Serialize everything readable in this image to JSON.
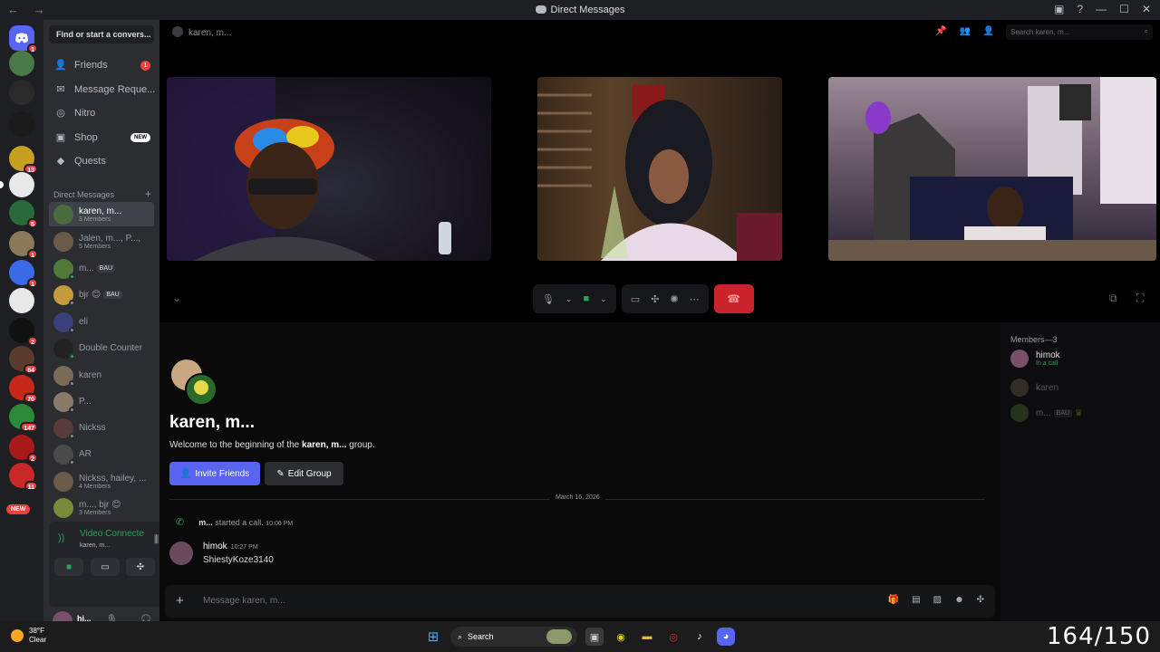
{
  "window": {
    "title": "Direct Messages",
    "nav_arrows": "← →",
    "controls": [
      "▣",
      "?",
      "—",
      "☐",
      "✕"
    ]
  },
  "rail": {
    "badges": [
      "1",
      "13",
      "5",
      "1",
      "1",
      "2",
      "64",
      "70",
      "147",
      "2",
      "11"
    ],
    "new_label": "NEW"
  },
  "sidebar": {
    "search_label": "Find or start a convers...",
    "nav": [
      {
        "label": "Friends",
        "icon": "friends-icon",
        "count": "1"
      },
      {
        "label": "Message Reque...",
        "icon": "envelope-icon"
      },
      {
        "label": "Nitro",
        "icon": "nitro-icon"
      },
      {
        "label": "Shop",
        "icon": "shop-icon",
        "tag": "NEW"
      },
      {
        "label": "Quests",
        "icon": "quests-icon"
      }
    ],
    "dm_header": "Direct Messages",
    "dm_add": "+",
    "dms": [
      {
        "name": "karen, m...",
        "sub": "3 Members",
        "active": true,
        "color": "#4a6b3c"
      },
      {
        "name": "Jalen, m..., P...,",
        "sub": "5 Members",
        "color": "#6a5a48"
      },
      {
        "name": "m...",
        "tag": "BAU",
        "color": "#4f7a3a",
        "online": true
      },
      {
        "name": "bjr 😊",
        "tag": "BAU",
        "color": "#c49a3a"
      },
      {
        "name": "eli",
        "color": "#3b3f7a"
      },
      {
        "name": "Double Counter",
        "color": "#222",
        "online": true
      },
      {
        "name": "karen",
        "color": "#7a6a58"
      },
      {
        "name": "P...",
        "color": "#8a7a6a"
      },
      {
        "name": "Nickss",
        "color": "#5a3a3a"
      },
      {
        "name": "AR",
        "color": "#4a4a4a"
      },
      {
        "name": "Nickss, hailey, ...",
        "sub": "4 Members",
        "color": "#6a5a4a"
      },
      {
        "name": "m..., bjr 😊",
        "sub": "3 Members",
        "color": "#7a8a3a"
      }
    ],
    "voice": {
      "title": "Video Connecte",
      "channel": "karen, m..."
    },
    "user": {
      "name": "hi...",
      "status": "In"
    }
  },
  "main": {
    "channel_name": "karen, m...",
    "search_placeholder": "Search karen, m...",
    "group_title": "karen, m...",
    "welcome_prefix": "Welcome to the beginning of the ",
    "welcome_name": "karen, m...",
    "welcome_suffix": " group.",
    "invite_label": "Invite Friends",
    "edit_label": "Edit Group",
    "date_divider": "March 16, 2026",
    "call_user": "m...",
    "call_text": " started a call.",
    "call_time": "10:06 PM",
    "message": {
      "author": "himok",
      "time": "10:27 PM",
      "text": "ShiestyKoze3140"
    },
    "composer_placeholder": "Message karen, m..."
  },
  "members": {
    "header": "Members—3",
    "list": [
      {
        "name": "himok",
        "status": "In a call",
        "dim": false,
        "color": "#7a4f6a"
      },
      {
        "name": "karen",
        "status": "",
        "dim": true,
        "color": "#7a6a58"
      },
      {
        "name": "m...",
        "status": "",
        "tag": "BAU",
        "dim": true,
        "color": "#4f7a3a"
      }
    ]
  },
  "taskbar": {
    "temp": "38°F",
    "condition": "Clear",
    "search_label": "Search",
    "overlay": "164/150"
  }
}
